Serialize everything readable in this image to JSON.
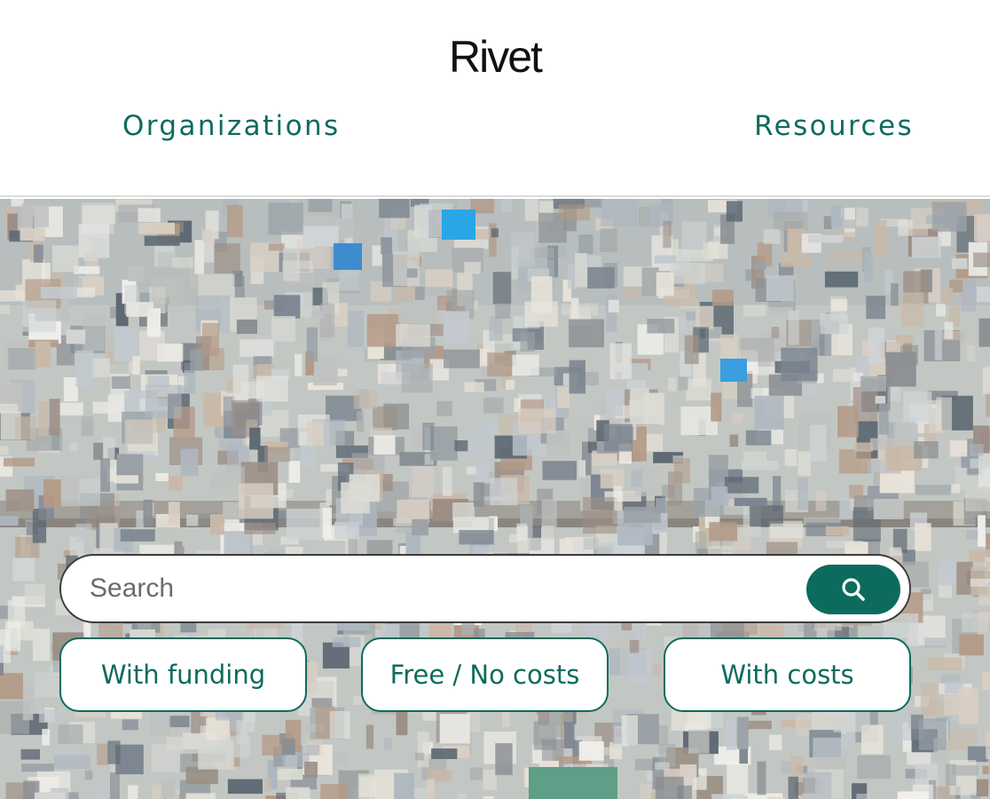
{
  "header": {
    "logo": "Rivet",
    "nav": {
      "organizations": "Organizations",
      "resources": "Resources"
    }
  },
  "search": {
    "placeholder": "Search",
    "button_icon": "search-icon"
  },
  "filters": [
    {
      "label": "With funding"
    },
    {
      "label": "Free / No costs"
    },
    {
      "label": "With costs"
    }
  ],
  "colors": {
    "brand": "#0d6b5e",
    "logo": "#111111",
    "hero_placeholder": "#c4c7c3"
  }
}
